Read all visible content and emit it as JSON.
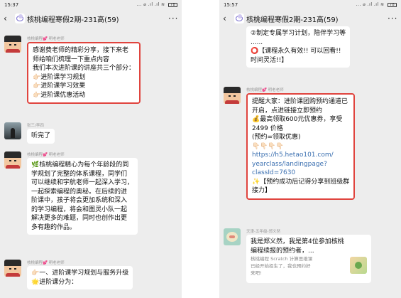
{
  "left_phone": {
    "status": {
      "time": "15:37",
      "icons": "... ⌀ .ıl .ıl ≋",
      "battery": "78"
    },
    "nav": {
      "back": "‹",
      "title": "核桃编程寒假2期-231高(59)",
      "more": "···"
    },
    "messages": [
      {
        "sender": "核桃编程💕 明老老师",
        "lines": [
          "感谢费老师的精彩分享，接下来老",
          "师给咱们梳理一下重点内容",
          "我们本次进阶课的讲座共三个部分：",
          "👉🏻进阶课学习规划",
          "👉🏻进阶课学习效果",
          "👉🏻进阶课优惠活动"
        ]
      },
      {
        "sender": "张三/李四",
        "lines": [
          "听完了"
        ]
      },
      {
        "sender": "核桃编程💕 明老老师",
        "lines": [
          "🌿核桃编程精心为每个年龄段的同",
          "学规划了完整的体系课程，同学们",
          "可以继续和宇航老师一起深入学习，",
          "一起探索编程的奥秘。在后续的进",
          "阶课中，孩子将会更加系统和深入",
          "的学习编程，将会和图灵小队一起",
          "解决更多的难题，同时也创作出更",
          "多有趣的作品。"
        ]
      },
      {
        "sender": "核桃编程💕 明老老师",
        "lines": [
          "👉🏻一、进阶课学习规划与服务升级",
          "🌟进阶课分为："
        ]
      }
    ]
  },
  "right_phone": {
    "status": {
      "time": "15:57",
      "icons": "... ⌀ .ıl .ıl ≋",
      "battery": "78"
    },
    "nav": {
      "back": "‹",
      "title": "核桃编程寒假2期-231高(59)",
      "more": "···"
    },
    "messages": [
      {
        "sender": "",
        "lines": [
          "②制定专属学习计划，陪伴学习等",
          "......",
          "⭕【课程永久有效!! 可以回看!!",
          "时间灵活!!】"
        ]
      },
      {
        "sender": "核桃编程💕 明老老师",
        "lines": [
          "提醒大家：进阶课团购预约通道已",
          "开启，点进链接立即预约",
          "💰最高领取600元优惠券，享受",
          "2499 价格",
          "(预约=领取优惠)",
          "👇🏻👇🏻👇🏻👇🏻",
          "https://h5.hetao101.com/",
          "yearclass/landingpage?",
          "classId=7630",
          "✨【预约成功后记得分享到班级群",
          "接力】"
        ]
      },
      {
        "sender": "天津-五年级-郑义然",
        "card_title": [
          "我是郑义然，我是第4位参加核桃",
          "编程续报的预约者，..."
        ],
        "card_desc": [
          "核桃编程 Scratch 计算思维课",
          "已经开始招生了，我也预约好",
          "来吧!"
        ]
      }
    ]
  }
}
